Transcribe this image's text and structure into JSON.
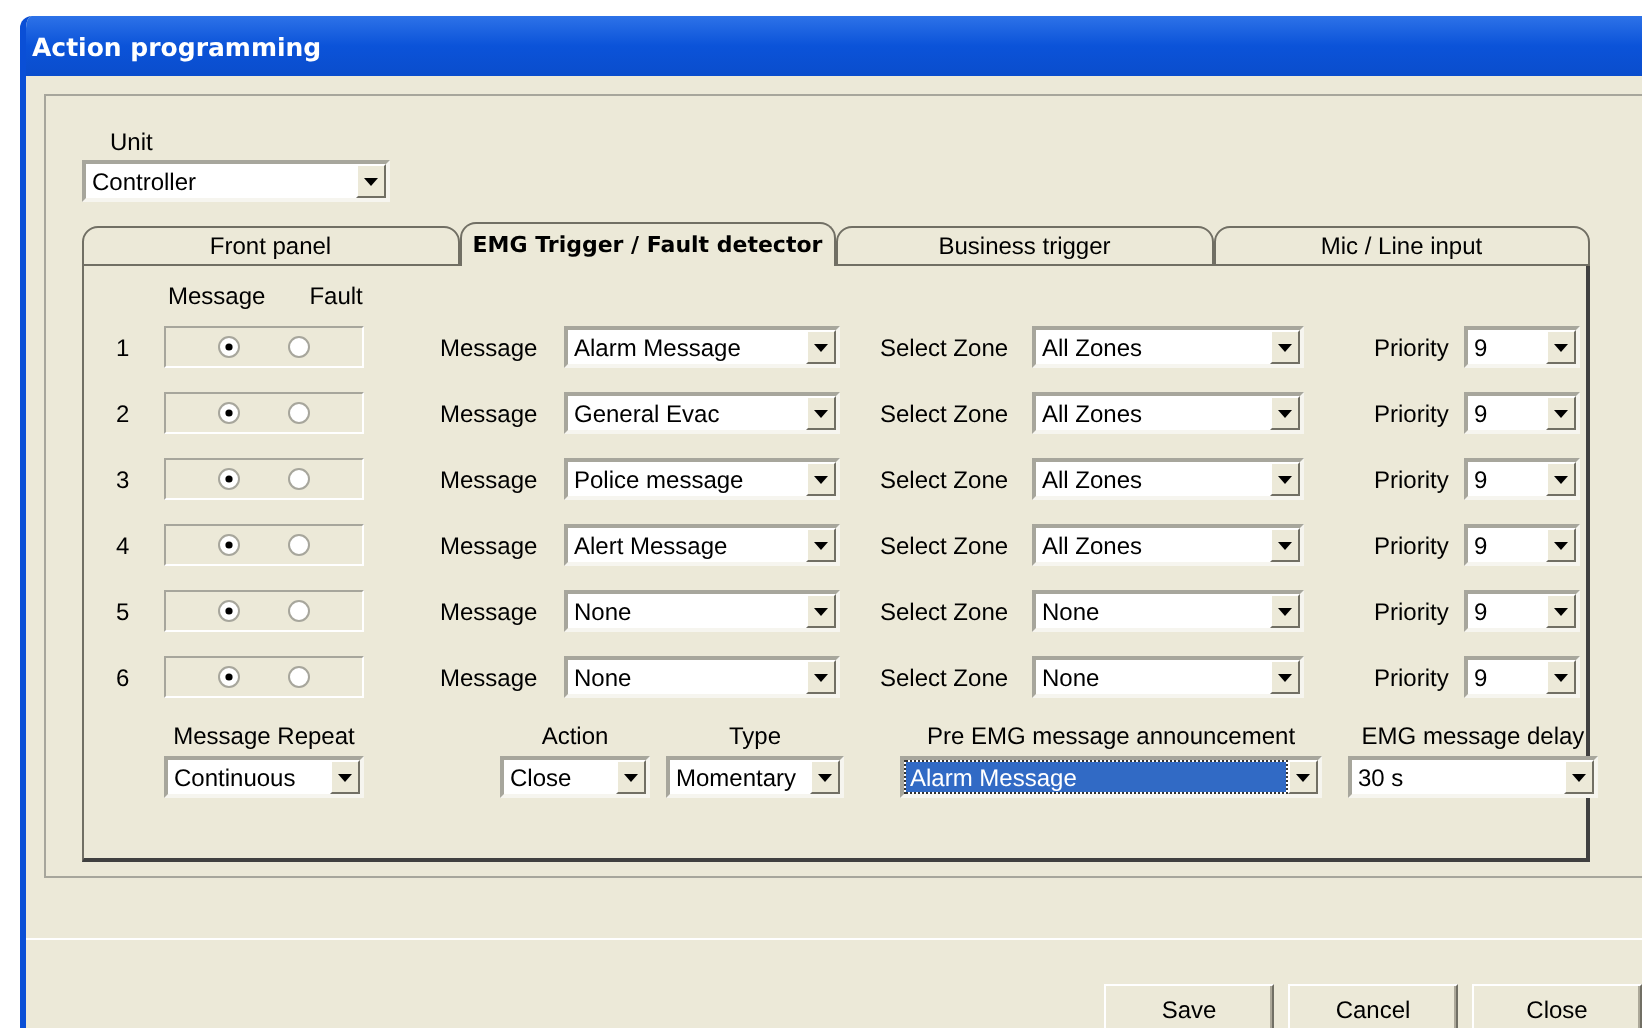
{
  "window": {
    "title": "Action programming"
  },
  "unit": {
    "label": "Unit",
    "value": "Controller"
  },
  "tabs": [
    {
      "label": "Front panel",
      "selected": false
    },
    {
      "label": "EMG Trigger / Fault detector",
      "selected": true
    },
    {
      "label": "Business trigger",
      "selected": false
    },
    {
      "label": "Mic / Line input",
      "selected": false
    }
  ],
  "radio_headers": [
    "Message",
    "Fault"
  ],
  "rows": [
    {
      "number": "1",
      "radios": [
        {
          "selected": true
        },
        {
          "selected": false
        }
      ],
      "message_label": "Message",
      "message": "Alarm Message",
      "zone_label": "Select Zone",
      "zone": "All Zones",
      "priority_label": "Priority",
      "priority": "9"
    },
    {
      "number": "2",
      "radios": [
        {
          "selected": true
        },
        {
          "selected": false
        }
      ],
      "message_label": "Message",
      "message": "General Evac",
      "zone_label": "Select Zone",
      "zone": "All Zones",
      "priority_label": "Priority",
      "priority": "9"
    },
    {
      "number": "3",
      "radios": [
        {
          "selected": true
        },
        {
          "selected": false
        }
      ],
      "message_label": "Message",
      "message": "Police message",
      "zone_label": "Select Zone",
      "zone": "All Zones",
      "priority_label": "Priority",
      "priority": "9"
    },
    {
      "number": "4",
      "radios": [
        {
          "selected": true
        },
        {
          "selected": false
        }
      ],
      "message_label": "Message",
      "message": "Alert Message",
      "zone_label": "Select Zone",
      "zone": "All Zones",
      "priority_label": "Priority",
      "priority": "9"
    },
    {
      "number": "5",
      "radios": [
        {
          "selected": true
        },
        {
          "selected": false
        }
      ],
      "message_label": "Message",
      "message": "None",
      "zone_label": "Select Zone",
      "zone": "None",
      "priority_label": "Priority",
      "priority": "9"
    },
    {
      "number": "6",
      "radios": [
        {
          "selected": true
        },
        {
          "selected": false
        }
      ],
      "message_label": "Message",
      "message": "None",
      "zone_label": "Select Zone",
      "zone": "None",
      "priority_label": "Priority",
      "priority": "9"
    }
  ],
  "settings": [
    {
      "label": "Message Repeat",
      "value": "Continuous",
      "highlighted": false
    },
    {
      "label": "Action",
      "value": "Close",
      "highlighted": false
    },
    {
      "label": "Type",
      "value": "Momentary",
      "highlighted": false
    },
    {
      "label": "Pre EMG message announcement",
      "value": "Alarm Message",
      "highlighted": true
    },
    {
      "label": "EMG message delay",
      "value": "30 s",
      "highlighted": false
    }
  ],
  "buttons": [
    "Save",
    "Cancel",
    "Close"
  ]
}
